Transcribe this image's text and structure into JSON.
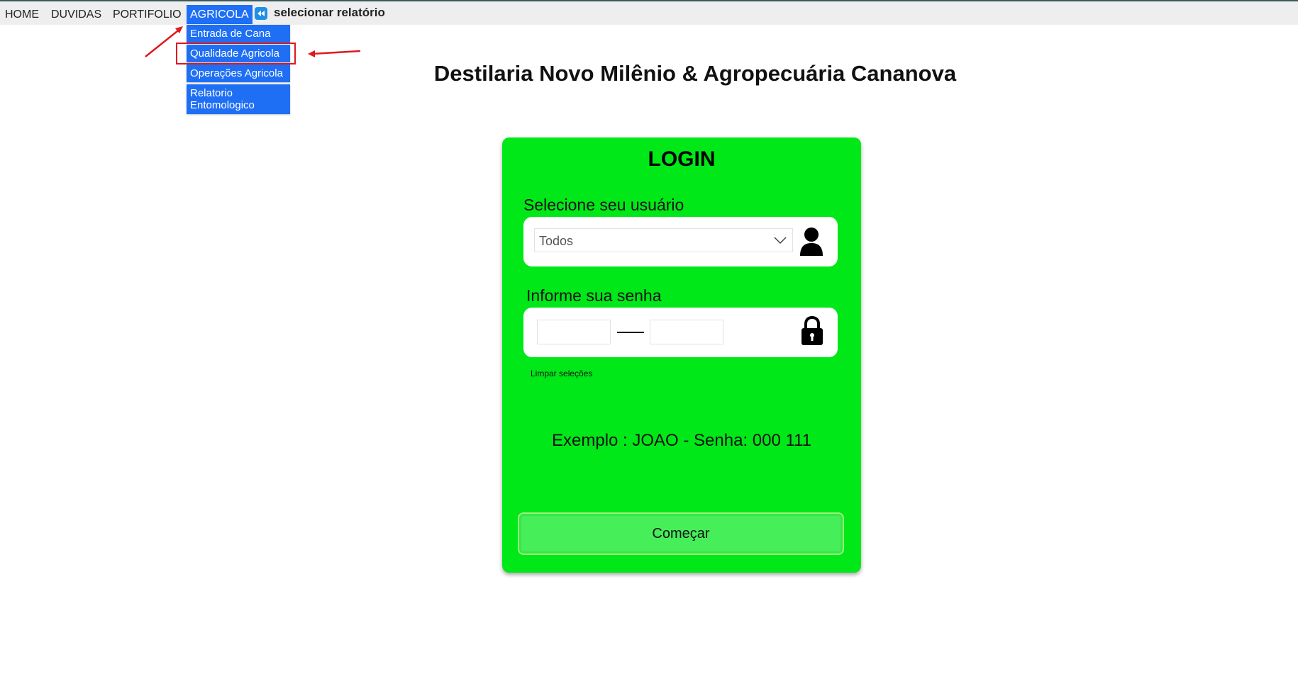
{
  "nav": {
    "items": [
      {
        "label": "HOME"
      },
      {
        "label": "DUVIDAS"
      },
      {
        "label": "PORTIFOLIO"
      },
      {
        "label": "AGRICOLA"
      }
    ],
    "report_title": "selecionar relatório"
  },
  "dropdown": {
    "items": [
      {
        "label": "Entrada de Cana"
      },
      {
        "label": "Qualidade Agricola"
      },
      {
        "label": "Operações Agricola"
      },
      {
        "label": "Relatorio Entomologico"
      }
    ]
  },
  "header": {
    "title": "Destilaria Novo Milênio  & Agropecuária Cananova"
  },
  "login": {
    "title": "LOGIN",
    "user_label": "Selecione seu usuário",
    "user_value": "Todos",
    "password_label": "Informe sua senha",
    "clear_label": "Limpar seleções",
    "example": "Exemplo : JOAO - Senha: 000  111",
    "start_label": "Começar"
  },
  "colors": {
    "card": "#00e817",
    "menu": "#1f6ff5",
    "annotation": "#e0181f",
    "button": "#46ef5a"
  },
  "icons": [
    "back-icon",
    "chevron-down-icon",
    "user-icon",
    "lock-icon"
  ]
}
